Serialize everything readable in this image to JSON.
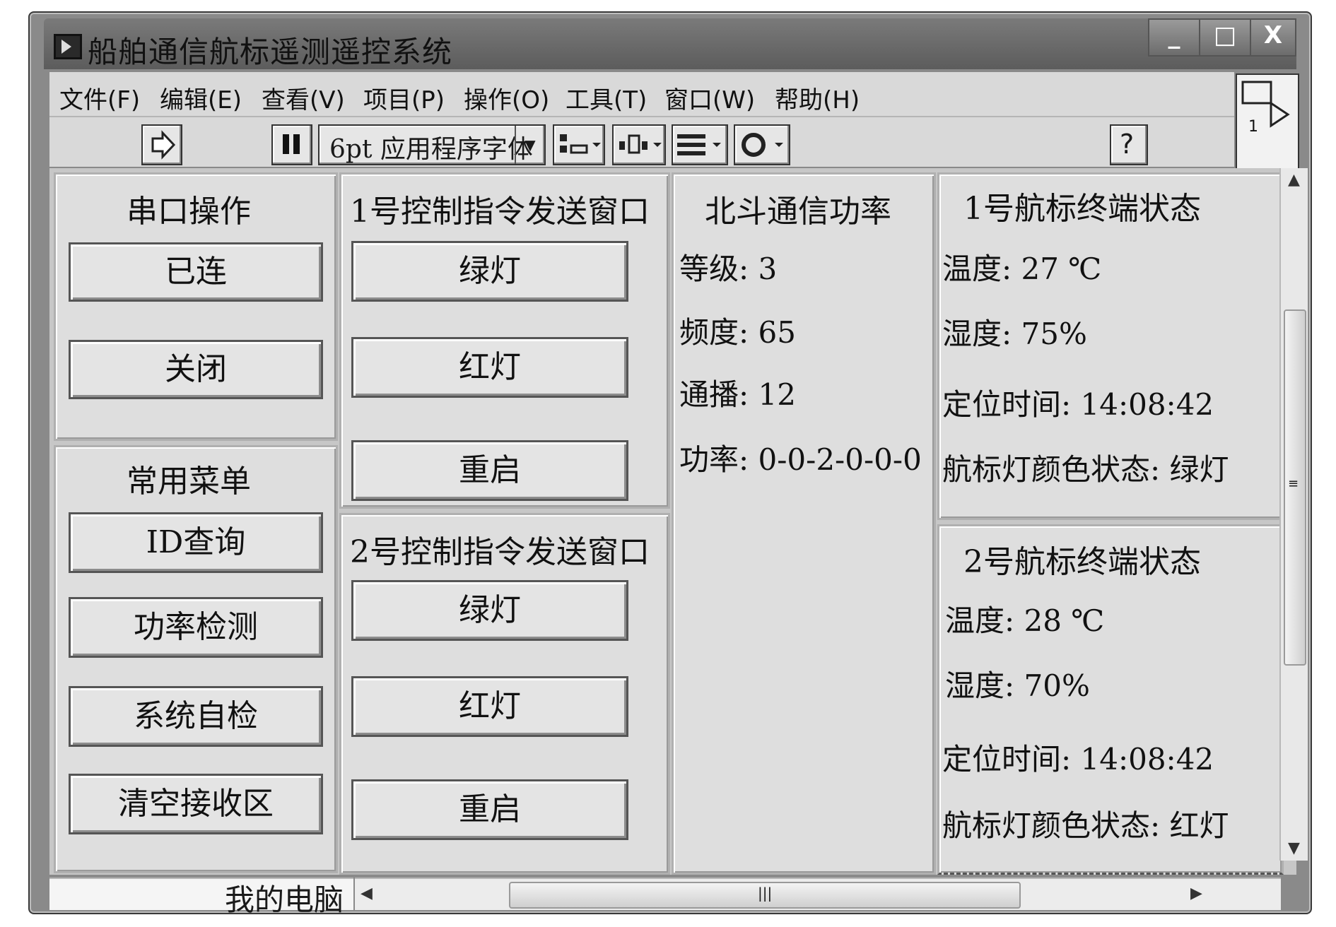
{
  "window": {
    "title": "船舶通信航标遥测遥控系统"
  },
  "menu": [
    "文件(F)",
    "编辑(E)",
    "查看(V)",
    "项目(P)",
    "操作(O)",
    "工具(T)",
    "窗口(W)",
    "帮助(H)"
  ],
  "toolbar": {
    "font_select": "6pt 应用程序字体"
  },
  "panel_icon_number": "1",
  "serial": {
    "title": "串口操作",
    "connected": "已连",
    "close": "关闭"
  },
  "common_menu": {
    "title": "常用菜单",
    "id_query": "ID查询",
    "power_check": "功率检测",
    "self_test": "系统自检",
    "clear": "清空接收区"
  },
  "ctrl1": {
    "title": "1号控制指令发送窗口",
    "green": "绿灯",
    "red": "红灯",
    "restart": "重启"
  },
  "ctrl2": {
    "title": "2号控制指令发送窗口",
    "green": "绿灯",
    "red": "红灯",
    "restart": "重启"
  },
  "beidou": {
    "title": "北斗通信功率",
    "level": "等级: 3",
    "freq": "频度: 65",
    "broadcast": "通播: 12",
    "power": "功率: 0-0-2-0-0-0"
  },
  "buoy1": {
    "title": "1号航标终端状态",
    "temp": "温度: 27 ℃",
    "humidity": "湿度: 75%",
    "fix_time": "定位时间: 14:08:42",
    "light": "航标灯颜色状态: 绿灯"
  },
  "buoy2": {
    "title": "2号航标终端状态",
    "temp": "温度: 28 ℃",
    "humidity": "湿度: 70%",
    "fix_time": "定位时间: 14:08:42",
    "light": "航标灯颜色状态: 红灯"
  },
  "statusbar": {
    "label": "我的电脑"
  }
}
